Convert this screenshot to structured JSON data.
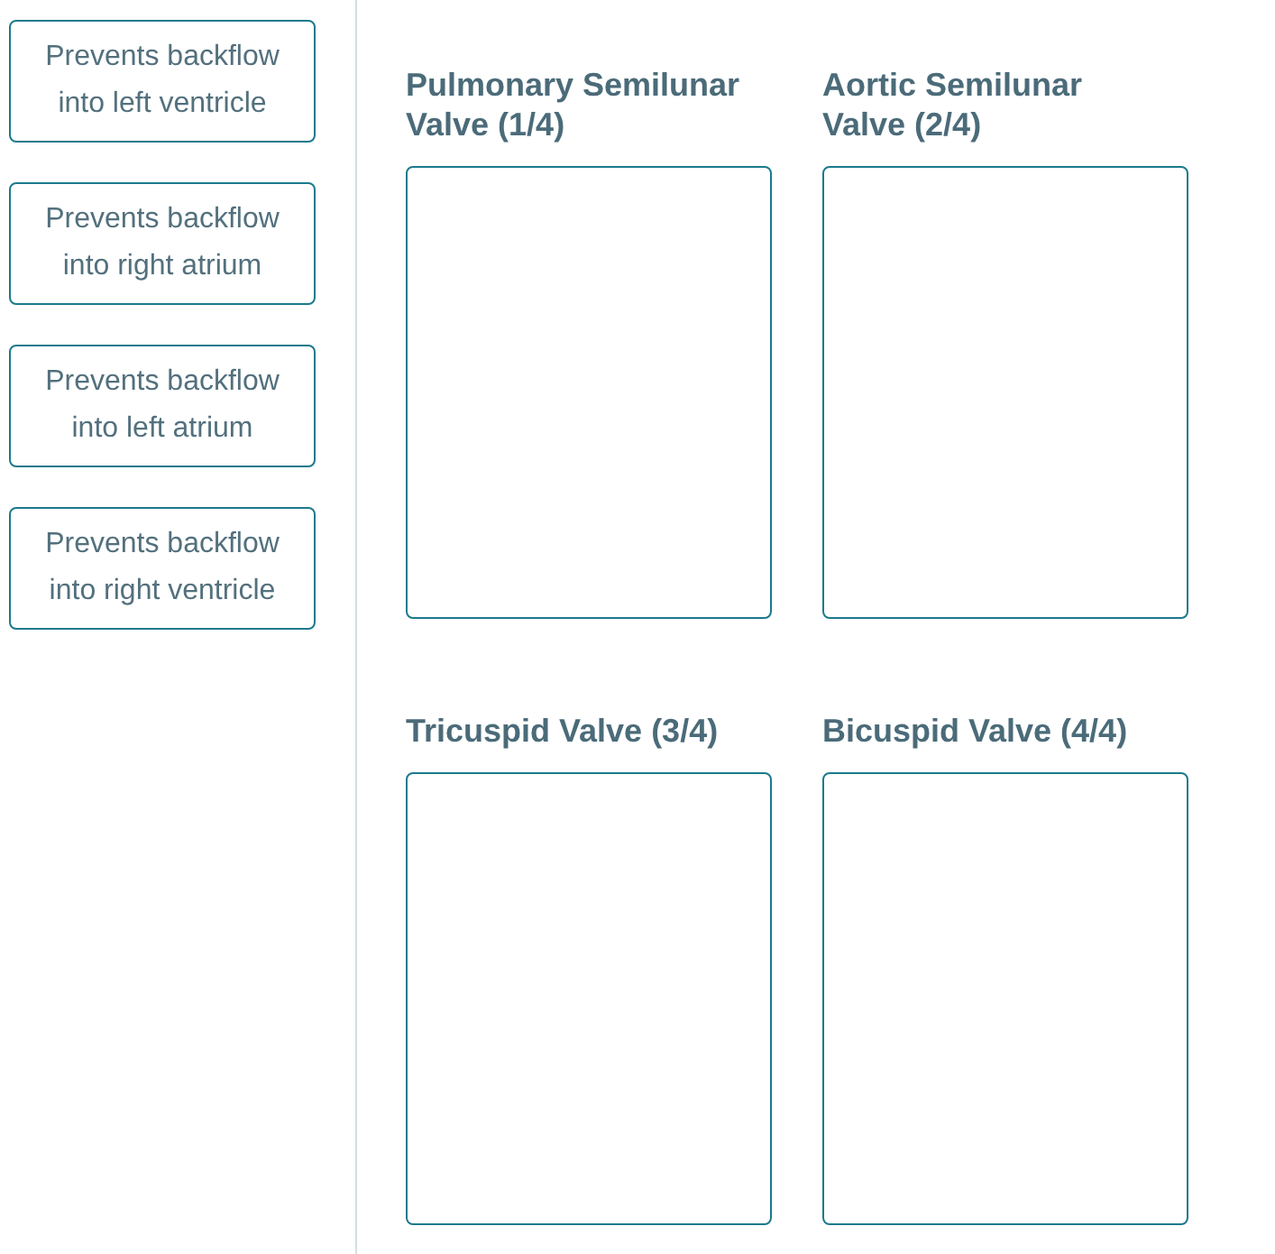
{
  "answers": [
    {
      "label": "Prevents backflow into left ventricle"
    },
    {
      "label": "Prevents backflow into right atrium"
    },
    {
      "label": "Prevents backflow into left atrium"
    },
    {
      "label": "Prevents backflow into right ventricle"
    }
  ],
  "targets": [
    {
      "title": "Pulmonary Semilunar Valve (1/4)"
    },
    {
      "title": "Aortic Semilunar Valve (2/4)"
    },
    {
      "title": "Tricuspid Valve (3/4)"
    },
    {
      "title": "Bicuspid Valve (4/4)"
    }
  ]
}
